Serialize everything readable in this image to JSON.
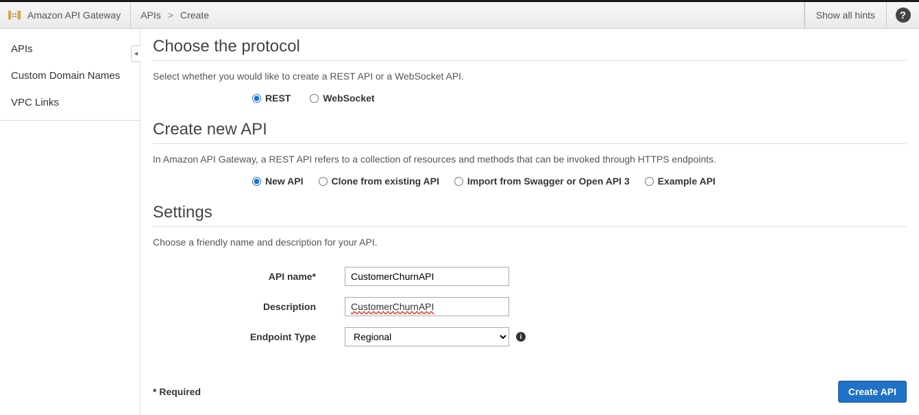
{
  "header": {
    "service_name": "Amazon API Gateway",
    "breadcrumb": {
      "root": "APIs",
      "sep": ">",
      "current": "Create"
    },
    "show_hints": "Show all hints"
  },
  "sidebar": {
    "items": [
      {
        "label": "APIs"
      },
      {
        "label": "Custom Domain Names"
      },
      {
        "label": "VPC Links"
      }
    ]
  },
  "protocol": {
    "title": "Choose the protocol",
    "desc": "Select whether you would like to create a REST API or a WebSocket API.",
    "options": {
      "rest": "REST",
      "websocket": "WebSocket"
    }
  },
  "create_api": {
    "title": "Create new API",
    "desc": "In Amazon API Gateway, a REST API refers to a collection of resources and methods that can be invoked through HTTPS endpoints.",
    "options": {
      "new": "New API",
      "clone": "Clone from existing API",
      "import": "Import from Swagger or Open API 3",
      "example": "Example API"
    }
  },
  "settings": {
    "title": "Settings",
    "desc": "Choose a friendly name and description for your API.",
    "fields": {
      "api_name_label": "API name*",
      "api_name_value": "CustomerChurnAPI",
      "description_label": "Description",
      "description_value": "CustomerChurnAPI",
      "endpoint_type_label": "Endpoint Type",
      "endpoint_type_value": "Regional"
    }
  },
  "footer": {
    "required": "* Required",
    "create_btn": "Create API"
  }
}
